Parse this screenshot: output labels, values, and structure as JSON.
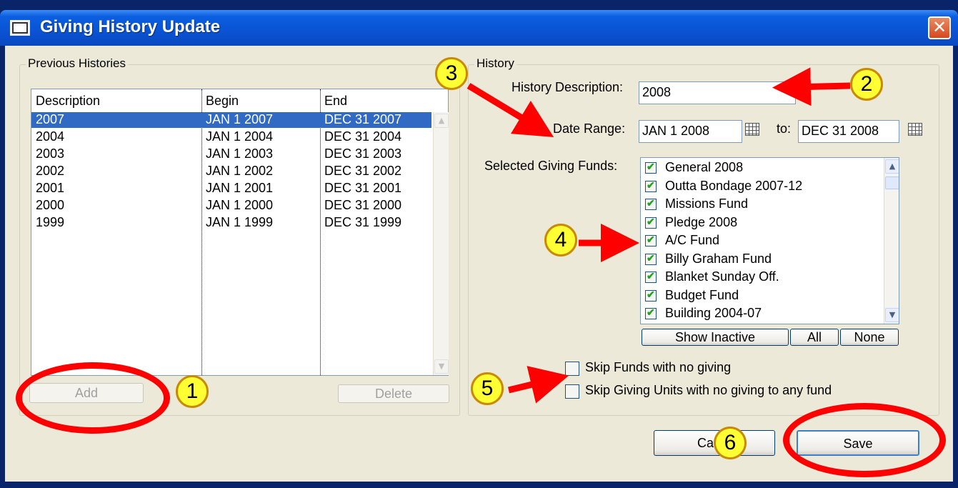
{
  "window": {
    "title": "Giving History Update",
    "close_label": "✕"
  },
  "previous_histories": {
    "legend": "Previous Histories",
    "columns": [
      "Description",
      "Begin",
      "End"
    ],
    "rows": [
      {
        "description": "2007",
        "begin": "JAN 1 2007",
        "end": "DEC 31 2007",
        "selected": true
      },
      {
        "description": "2004",
        "begin": "JAN 1 2004",
        "end": "DEC 31 2004"
      },
      {
        "description": "2003",
        "begin": "JAN 1 2003",
        "end": "DEC 31 2003"
      },
      {
        "description": "2002",
        "begin": "JAN 1 2002",
        "end": "DEC 31 2002"
      },
      {
        "description": "2001",
        "begin": "JAN 1 2001",
        "end": "DEC 31 2001"
      },
      {
        "description": "2000",
        "begin": "JAN 1 2000",
        "end": "DEC 31 2000"
      },
      {
        "description": "1999",
        "begin": "JAN 1 1999",
        "end": "DEC 31 1999"
      }
    ],
    "add_label": "Add",
    "delete_label": "Delete"
  },
  "history": {
    "legend": "History",
    "description_label": "History Description:",
    "description_value": "2008",
    "date_range_label": "Date Range:",
    "date_from": "JAN 1 2008",
    "to_label": "to:",
    "date_to": "DEC 31 2008",
    "funds_label": "Selected Giving Funds:",
    "funds": [
      {
        "name": "General 2008",
        "checked": true
      },
      {
        "name": "Outta Bondage 2007-12",
        "checked": true
      },
      {
        "name": "Missions Fund",
        "checked": true
      },
      {
        "name": "Pledge 2008",
        "checked": true
      },
      {
        "name": "A/C Fund",
        "checked": true
      },
      {
        "name": "Billy Graham Fund",
        "checked": true
      },
      {
        "name": "Blanket Sunday Off.",
        "checked": true
      },
      {
        "name": "Budget Fund",
        "checked": true
      },
      {
        "name": "Building 2004-07",
        "checked": true
      }
    ],
    "show_inactive_label": "Show Inactive",
    "all_label": "All",
    "none_label": "None",
    "skip_funds_label": "Skip Funds with no giving",
    "skip_units_label": "Skip Giving Units with no giving to any fund"
  },
  "footer": {
    "cancel_label": "Ca",
    "save_label": "Save"
  },
  "callouts": [
    "1",
    "2",
    "3",
    "4",
    "5",
    "6"
  ],
  "colors": {
    "selection": "#316ac5",
    "annotation_red": "#ff0000",
    "callout_yellow": "#ffff33"
  }
}
